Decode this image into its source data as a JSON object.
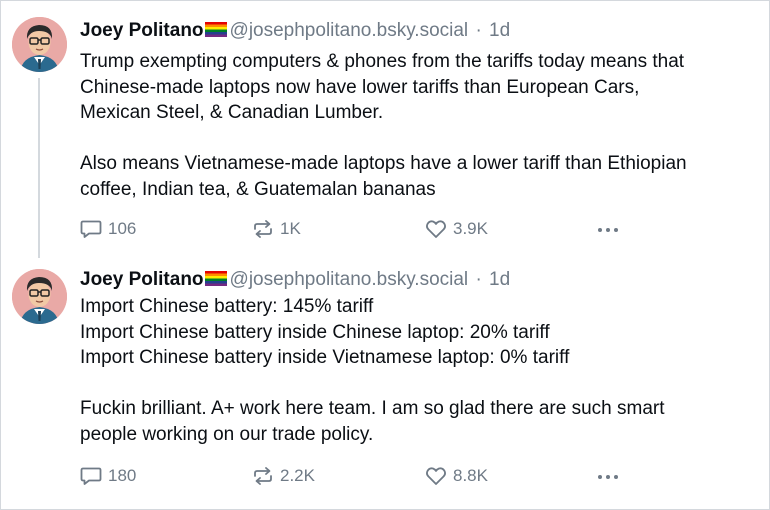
{
  "posts": [
    {
      "author": "Joey Politano",
      "handle": "@josephpolitano.bsky.social",
      "separator": "·",
      "time": "1d",
      "paragraphs": [
        [
          "Trump exempting computers & phones from the tariffs today means that",
          "Chinese-made laptops now have lower tariffs than European Cars,",
          "Mexican Steel, & Canadian Lumber."
        ],
        [
          "Also means Vietnamese-made laptops have a lower tariff than Ethiopian",
          "coffee, Indian tea, & Guatemalan bananas"
        ]
      ],
      "replies": "106",
      "reposts": "1K",
      "likes": "3.9K"
    },
    {
      "author": "Joey Politano",
      "handle": "@josephpolitano.bsky.social",
      "separator": "·",
      "time": "1d",
      "paragraphs": [
        [
          "Import Chinese battery: 145% tariff",
          "Import Chinese battery inside Chinese laptop: 20% tariff",
          "Import Chinese battery inside Vietnamese laptop: 0% tariff"
        ],
        [
          "Fuckin brilliant. A+ work here team. I am so glad there are such smart",
          "people working on our trade policy."
        ]
      ],
      "replies": "180",
      "reposts": "2.2K",
      "likes": "8.8K"
    }
  ],
  "icons": {
    "reply": "speech-bubble-icon",
    "repost": "repost-arrows-icon",
    "like": "heart-icon",
    "more": "ellipsis-icon",
    "flag": "rainbow-flag-icon",
    "avatar": "cartoon-avatar"
  },
  "colors": {
    "text": "#0b0f14",
    "muted": "#6f7a86",
    "thread_line": "#d4d9de",
    "avatar_bg": "#e9a9a6"
  }
}
